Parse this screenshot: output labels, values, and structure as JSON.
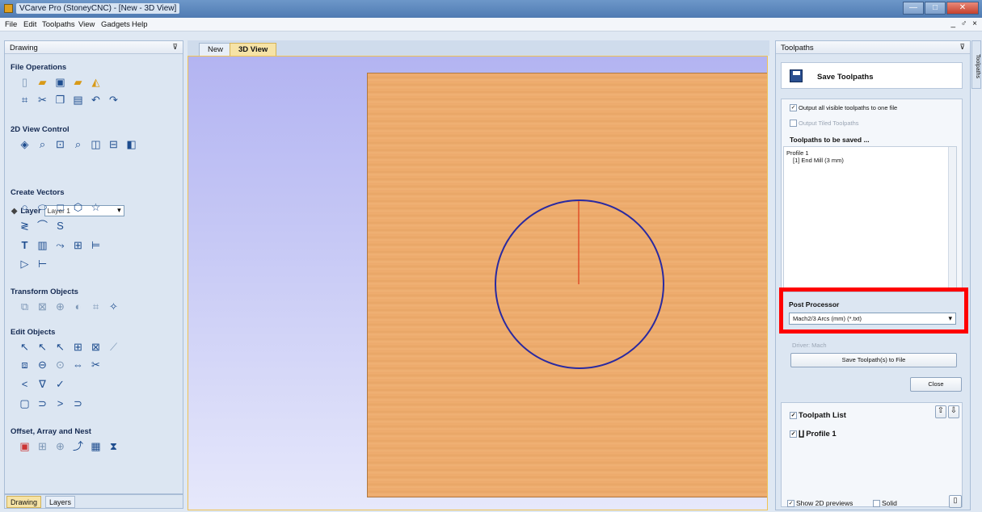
{
  "window": {
    "title": "VCarve Pro (StoneyCNC) - [New - 3D View]",
    "controls": [
      "—",
      "□",
      "✕"
    ]
  },
  "menu": {
    "items": [
      "File",
      "Edit",
      "Toolpaths",
      "View",
      "Gadgets",
      "Help"
    ],
    "mdi_controls": "_ ♂ ×"
  },
  "left_panel": {
    "title": "Drawing",
    "pin": "⊽",
    "sections": {
      "file_ops": "File Operations",
      "view_control": "2D View Control",
      "create_vectors": "Create Vectors",
      "transform": "Transform Objects",
      "edit_objects": "Edit Objects",
      "offset": "Offset, Array and Nest"
    },
    "layer_label": "Layer",
    "layer_value": "Layer 1",
    "bottom_tabs": [
      "Drawing",
      "Layers"
    ]
  },
  "doc_tabs": [
    "New",
    "3D View"
  ],
  "right_panel": {
    "title": "Toolpaths",
    "pin": "⊽",
    "side_tab": "Toolpaths",
    "save_title": "Save Toolpaths",
    "opt_visible_one_file": "Output all visible toolpaths to one file",
    "opt_tiled": "Output Tiled Toolpaths",
    "to_be_saved": "Toolpaths to be saved ...",
    "saved_items": [
      "Profile 1",
      "[1] End Mill (3 mm)"
    ],
    "post_processor_label": "Post Processor",
    "post_processor_value": "Mach2/3 Arcs (mm) (*.txt)",
    "driver_label": "Driver: Mach",
    "save_file_btn": "Save Toolpath(s) to File",
    "close_btn": "Close",
    "toolpath_list": "Toolpath List",
    "toolpath_items": [
      "Profile 1"
    ],
    "show_previews": "Show 2D previews",
    "solid": "Solid",
    "checked": "✓"
  }
}
